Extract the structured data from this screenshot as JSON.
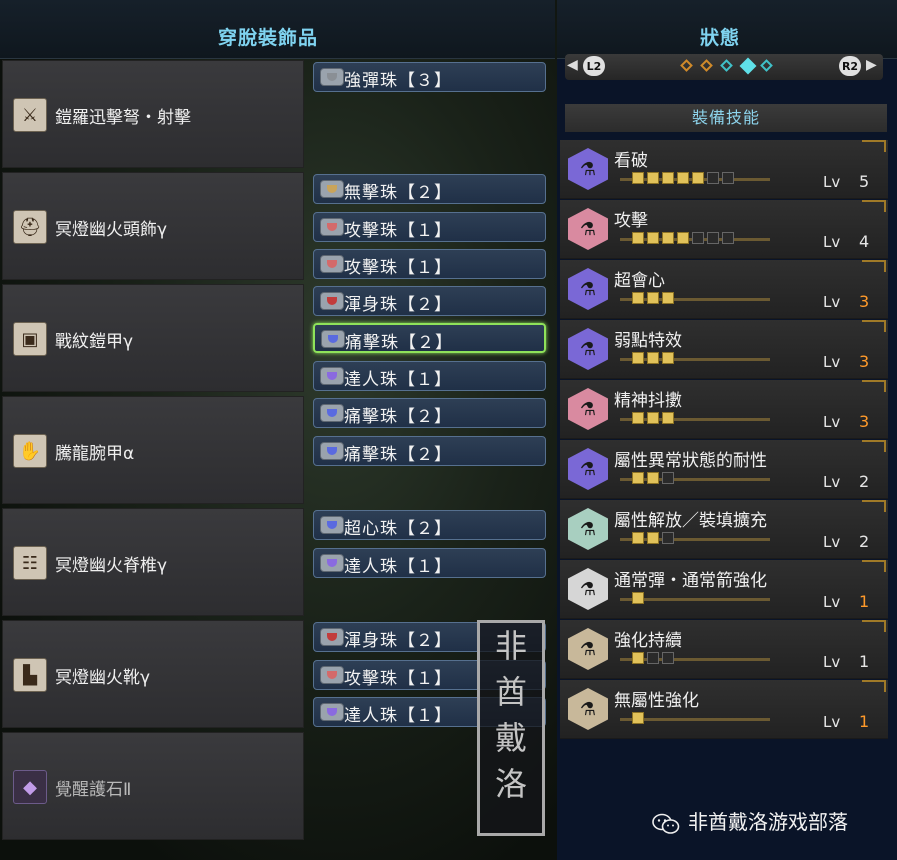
{
  "left_panel": {
    "title": "穿脫裝飾品",
    "equipment": [
      {
        "name": "鎧羅迅擊弩・射擊",
        "icon": "crossbow-icon",
        "dim": false
      },
      {
        "name": "冥燈幽火頭飾γ",
        "icon": "helmet-icon",
        "dim": false
      },
      {
        "name": "戰紋鎧甲γ",
        "icon": "chest-armor-icon",
        "dim": false
      },
      {
        "name": "騰龍腕甲α",
        "icon": "gauntlet-icon",
        "dim": false
      },
      {
        "name": "冥燈幽火脊椎γ",
        "icon": "waist-armor-icon",
        "dim": false
      },
      {
        "name": "冥燈幽火靴γ",
        "icon": "boots-icon",
        "dim": false
      },
      {
        "name": "覺醒護石Ⅱ",
        "icon": "charm-icon",
        "dim": true
      }
    ],
    "decorations": [
      {
        "label": "強彈珠【３】",
        "color": "#8a8f95"
      },
      {
        "label": "無擊珠【２】",
        "color": "#c9a45a"
      },
      {
        "label": "攻擊珠【１】",
        "color": "#d46a6a"
      },
      {
        "label": "攻擊珠【１】",
        "color": "#d46a6a"
      },
      {
        "label": "渾身珠【２】",
        "color": "#c23c3c"
      },
      {
        "label": "痛擊珠【２】",
        "color": "#5a6ae0",
        "selected": true
      },
      {
        "label": "達人珠【１】",
        "color": "#8a6ae0"
      },
      {
        "label": "痛擊珠【２】",
        "color": "#5a6ae0"
      },
      {
        "label": "痛擊珠【２】",
        "color": "#5a6ae0"
      },
      {
        "label": "超心珠【２】",
        "color": "#5a6ae0"
      },
      {
        "label": "達人珠【１】",
        "color": "#8a6ae0"
      },
      {
        "label": "渾身珠【２】",
        "color": "#c23c3c"
      },
      {
        "label": "攻擊珠【１】",
        "color": "#d46a6a"
      },
      {
        "label": "達人珠【１】",
        "color": "#8a6ae0"
      }
    ]
  },
  "right_panel": {
    "title": "狀態",
    "nav": {
      "left_button": "L2",
      "right_button": "R2",
      "pages": 5,
      "active_page": 4
    },
    "section_title": "裝備技能",
    "lv_label": "Lv",
    "skills": [
      {
        "name": "看破",
        "level": "5",
        "filled": 5,
        "slots": 7,
        "max": false,
        "color": "#7a68d6"
      },
      {
        "name": "攻擊",
        "level": "4",
        "filled": 4,
        "slots": 7,
        "max": false,
        "color": "#d98aa0"
      },
      {
        "name": "超會心",
        "level": "3",
        "filled": 3,
        "slots": 3,
        "max": true,
        "color": "#7a68d6"
      },
      {
        "name": "弱點特效",
        "level": "3",
        "filled": 3,
        "slots": 3,
        "max": true,
        "color": "#7a68d6"
      },
      {
        "name": "精神抖擻",
        "level": "3",
        "filled": 3,
        "slots": 3,
        "max": true,
        "color": "#d98aa0"
      },
      {
        "name": "屬性異常狀態的耐性",
        "level": "2",
        "filled": 2,
        "slots": 3,
        "max": false,
        "color": "#7a68d6"
      },
      {
        "name": "屬性解放／裝填擴充",
        "level": "2",
        "filled": 2,
        "slots": 3,
        "max": false,
        "color": "#a8cfc0"
      },
      {
        "name": "通常彈・通常箭強化",
        "level": "1",
        "filled": 1,
        "slots": 1,
        "max": true,
        "color": "#d6d6d6"
      },
      {
        "name": "強化持續",
        "level": "1",
        "filled": 1,
        "slots": 3,
        "max": false,
        "color": "#c8b89a"
      },
      {
        "name": "無屬性強化",
        "level": "1",
        "filled": 1,
        "slots": 1,
        "max": true,
        "color": "#c8b89a"
      }
    ]
  },
  "watermark": {
    "stamp_chars": [
      "非",
      "酋",
      "戴",
      "洛"
    ],
    "wechat_label": "非酋戴洛游戏部落"
  }
}
